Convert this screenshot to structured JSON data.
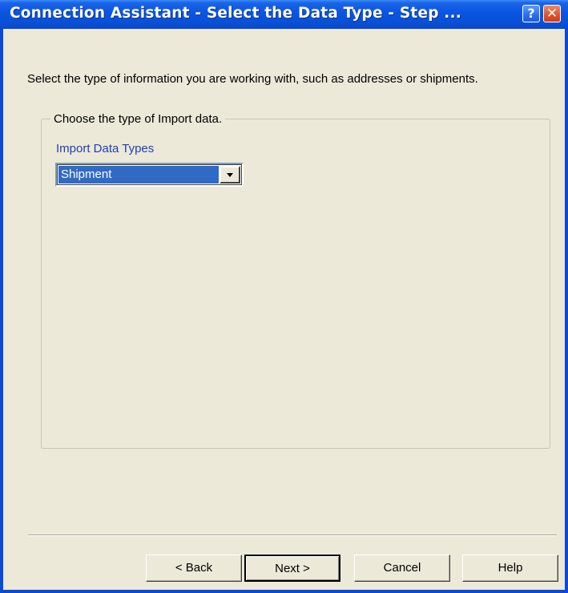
{
  "window": {
    "title": "Connection Assistant - Select the Data Type - Step ...",
    "help_button": "?",
    "close_button": "✕"
  },
  "instruction": "Select the type of information you are working with, such as addresses or shipments.",
  "group": {
    "legend": "Choose the type of Import data.",
    "field_label": "Import Data Types",
    "select_value": "Shipment"
  },
  "buttons": {
    "back": "< Back",
    "next": "Next >",
    "cancel": "Cancel",
    "help": "Help"
  },
  "colors": {
    "title_bar": "#0a55e0",
    "dialog_bg": "#ece9d8",
    "selection": "#316ac5",
    "label_blue": "#1f3fb8"
  },
  "icons": [
    "help-icon",
    "close-icon",
    "chevron-down-icon"
  ]
}
